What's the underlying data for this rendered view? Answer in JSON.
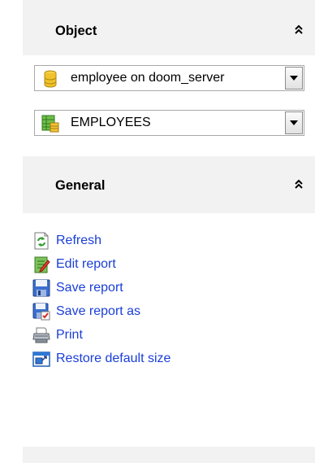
{
  "object_section": {
    "title": "Object",
    "database_combo": {
      "value": "employee on doom_server"
    },
    "table_combo": {
      "value": "EMPLOYEES"
    }
  },
  "general_section": {
    "title": "General",
    "actions": [
      {
        "label": "Refresh",
        "icon": "refresh-icon"
      },
      {
        "label": "Edit report",
        "icon": "edit-report-icon"
      },
      {
        "label": "Save report",
        "icon": "save-icon"
      },
      {
        "label": "Save report as",
        "icon": "save-as-icon"
      },
      {
        "label": "Print",
        "icon": "printer-icon"
      },
      {
        "label": "Restore default size",
        "icon": "restore-size-icon"
      }
    ]
  },
  "colors": {
    "panel_bg": "#f2f2f2",
    "link": "#1a3ed8"
  }
}
